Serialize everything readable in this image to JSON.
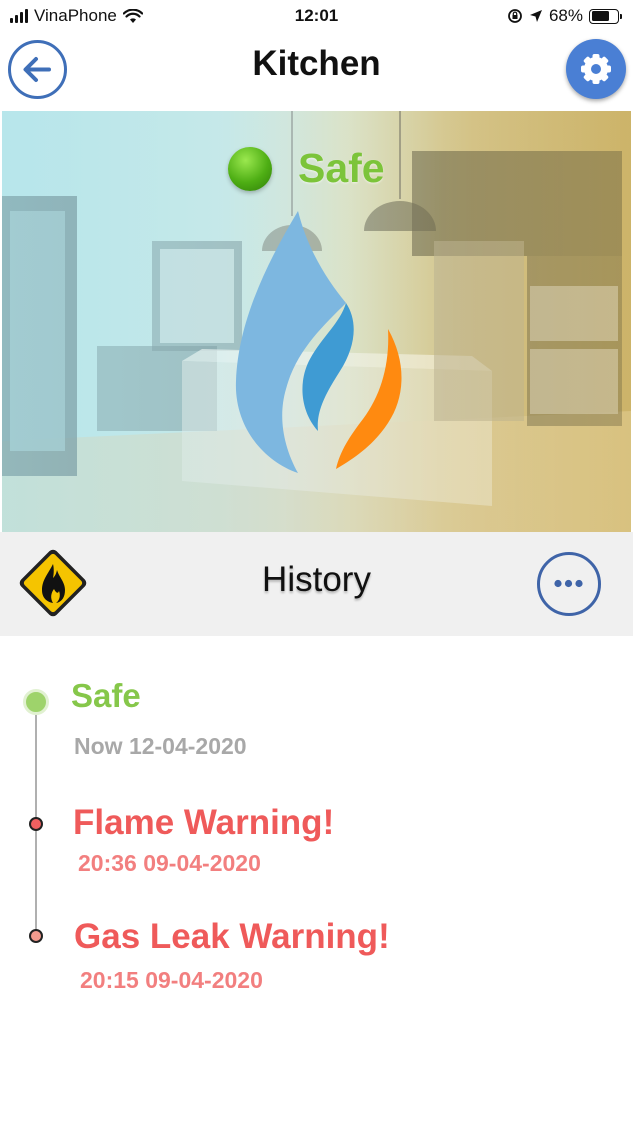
{
  "status_bar": {
    "carrier": "VinaPhone",
    "time": "12:01",
    "battery": "68%",
    "battery_level": 0.68
  },
  "header": {
    "title": "Kitchen",
    "back_icon": "arrow-left-icon",
    "settings_icon": "gear-icon"
  },
  "hero": {
    "status_text": "Safe",
    "status_color": "#7cc43a",
    "logo_icon": "flame-logo-icon"
  },
  "history": {
    "title": "History",
    "warning_icon": "fire-warning-icon",
    "more_icon": "more-horizontal-icon"
  },
  "events": [
    {
      "title": "Safe",
      "time": "Now 12-04-2020",
      "color": "#86c74a"
    },
    {
      "title": "Flame Warning!",
      "time": "20:36 09-04-2020",
      "color": "#ef5a5a"
    },
    {
      "title": "Gas Leak Warning!",
      "time": "20:15 09-04-2020",
      "color": "#ef5a5a"
    }
  ]
}
